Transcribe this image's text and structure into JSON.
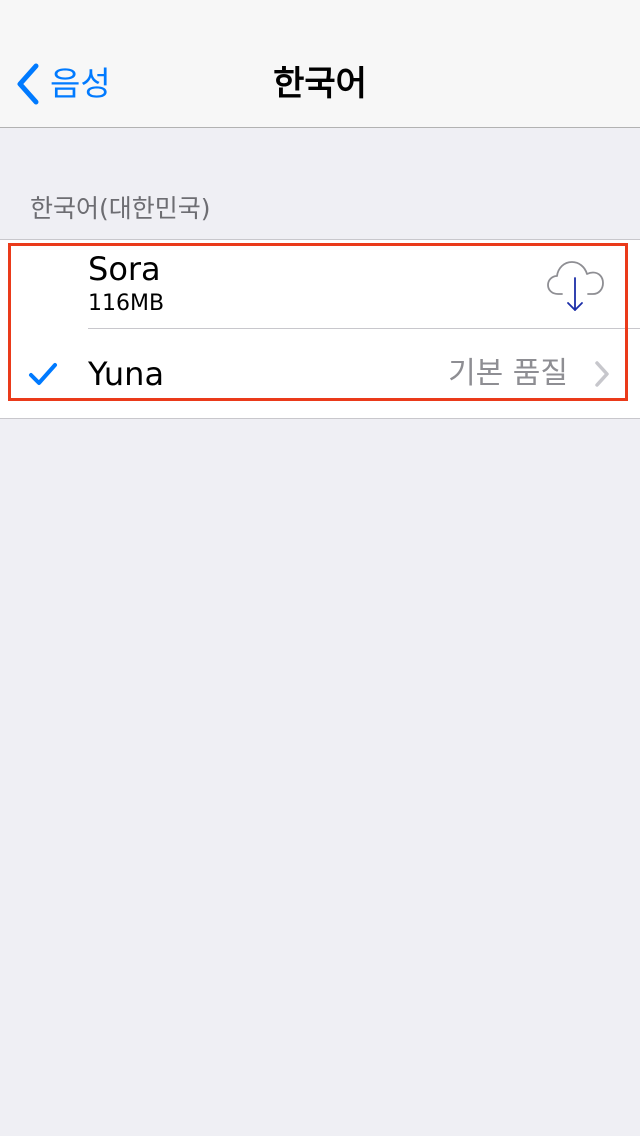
{
  "nav": {
    "back_label": "음성",
    "title": "한국어"
  },
  "section": {
    "header": "한국어(대한민국)",
    "voices": [
      {
        "name": "Sora",
        "size": "116MB",
        "action_icon": "cloud-download-icon",
        "selected": false
      },
      {
        "name": "Yuna",
        "detail": "기본 품질",
        "accessory_icon": "chevron-right-icon",
        "selected": true,
        "selected_icon": "checkmark-icon"
      }
    ]
  },
  "colors": {
    "accent": "#007aff",
    "highlight_border": "#ea3a1a",
    "background": "#efeff4",
    "secondary_text": "#8e8e93",
    "section_header_text": "#6d6d72"
  }
}
